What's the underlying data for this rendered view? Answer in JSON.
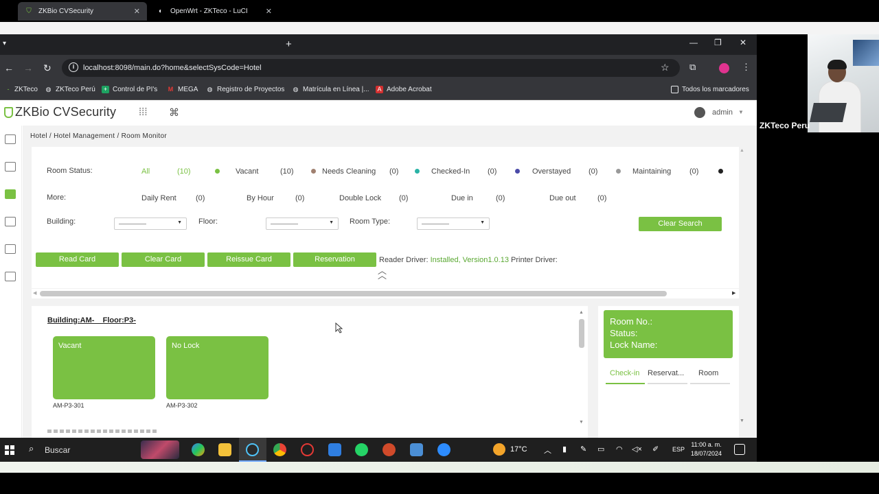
{
  "browser": {
    "tabs": [
      {
        "title": "ZKBio CVSecurity",
        "close": "✕"
      },
      {
        "title": "OpenWrt - ZKTeco - LuCI",
        "close": "✕"
      }
    ],
    "new_tab": "+",
    "url": "localhost:8098/main.do?home&selectSysCode=Hotel",
    "bookmarks": [
      "ZKTeco",
      "ZKTeco Perú",
      "Control de PI's",
      "MEGA",
      "Registro de Proyectos",
      "Matrícula en Línea |...",
      "Adobe Acrobat"
    ],
    "all_bookmarks": "Todos los marcadores"
  },
  "app": {
    "logo": "ZKBio CVSecurity",
    "user": "admin",
    "breadcrumb": "Hotel / Hotel Management / Room Monitor"
  },
  "filters": {
    "room_status_label": "Room Status:",
    "status_items": [
      {
        "label": "All",
        "count": "(10)"
      },
      {
        "label": "Vacant",
        "count": "(10)",
        "color": "#7ac143"
      },
      {
        "label": "Needs Cleaning",
        "count": "(0)",
        "color": "#a08070"
      },
      {
        "label": "Checked-In",
        "count": "(0)",
        "color": "#2ab3a6"
      },
      {
        "label": "Overstayed",
        "count": "(0)",
        "color": "#4a4aa8"
      },
      {
        "label": "Maintaining",
        "count": "(0)",
        "color": "#999999"
      }
    ],
    "more_label": "More:",
    "more_items": [
      {
        "label": "Daily Rent",
        "count": "(0)"
      },
      {
        "label": "By Hour",
        "count": "(0)"
      },
      {
        "label": "Double Lock",
        "count": "(0)"
      },
      {
        "label": "Due in",
        "count": "(0)"
      },
      {
        "label": "Due out",
        "count": "(0)"
      }
    ],
    "building_label": "Building:",
    "floor_label": "Floor:",
    "room_type_label": "Room Type:",
    "clear_search": "Clear Search"
  },
  "actions": {
    "read_card": "Read Card",
    "clear_card": "Clear Card",
    "reissue_card": "Reissue Card",
    "reservation": "Reservation",
    "driver_prefix": "Reader Driver:",
    "driver_installed": "Installed, Version1.0.13",
    "printer_driver": "Printer Driver:"
  },
  "rooms": {
    "heading": "Building:AM-    Floor:P3-",
    "cards": [
      {
        "status": "Vacant",
        "id": "AM-P3-301"
      },
      {
        "status": "No Lock",
        "id": "AM-P3-302"
      }
    ]
  },
  "detail": {
    "room_no": "Room No.:",
    "status": "Status:",
    "lock_name": "Lock Name:",
    "tabs": [
      "Check-in",
      "Reservat...",
      "Room"
    ]
  },
  "taskbar": {
    "search": "Buscar",
    "temperature": "17°C",
    "language": "ESP",
    "time": "11:00 a. m.",
    "date": "18/07/2024"
  },
  "webcam": {
    "name": "ZKTeco Peru"
  },
  "colors": {
    "accent": "#7ac143"
  }
}
